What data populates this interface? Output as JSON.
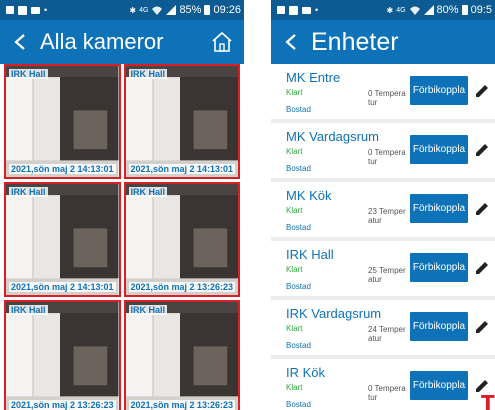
{
  "left": {
    "status_bar": {
      "battery": "85%",
      "time": "09:26",
      "network": "4G"
    },
    "title": "Alla kameror",
    "cameras": [
      {
        "name": "IRK Hall",
        "date": "2021,sön maj 23",
        "time": "14:13:01"
      },
      {
        "name": "IRK Hall",
        "date": "2021,sön maj 23",
        "time": "14:13:01"
      },
      {
        "name": "IRK Hall",
        "date": "2021,sön maj 23",
        "time": "14:13:01"
      },
      {
        "name": "IRK Hall",
        "date": "2021,sön maj 23",
        "time": "13:26:23"
      },
      {
        "name": "IRK Hall",
        "date": "2021,sön maj 23",
        "time": "13:26:23"
      },
      {
        "name": "IRK Hall",
        "date": "2021,sön maj 23",
        "time": "13:26:23"
      }
    ]
  },
  "right": {
    "status_bar": {
      "battery": "80%",
      "time": "09:5",
      "network": "4G"
    },
    "title": "Enheter",
    "devices": [
      {
        "name": "MK Entre",
        "status": "Klart",
        "room": "Bostad",
        "temp": "0 Temperatur",
        "button": "Förbikoppla"
      },
      {
        "name": "MK Vardagsrum",
        "status": "Klart",
        "room": "Bostad",
        "temp": "0 Temperatur",
        "button": "Förbikoppla"
      },
      {
        "name": "MK Kök",
        "status": "Klart",
        "room": "Bostad",
        "temp": "23 Temperatur",
        "button": "Förbikoppla"
      },
      {
        "name": "IRK Hall",
        "status": "Klart",
        "room": "Bostad",
        "temp": "25 Temperatur",
        "button": "Förbikoppla"
      },
      {
        "name": "IRK Vardagsrum",
        "status": "Klart",
        "room": "Bostad",
        "temp": "24 Temperatur",
        "button": "Förbikoppla"
      },
      {
        "name": "IR Kök",
        "status": "Klart",
        "room": "Bostad",
        "temp": "0 Temperatur",
        "button": "Förbikoppla"
      }
    ]
  },
  "colors": {
    "appbar": "#0e72b9",
    "statusbar": "#0d5b93",
    "tile_border": "#d81f26",
    "status_ok": "#2eaa3c"
  },
  "icons": [
    "back-arrow-icon",
    "home-icon",
    "edit-pencil-icon",
    "signal-icon",
    "wifi-icon",
    "battery-icon"
  ]
}
